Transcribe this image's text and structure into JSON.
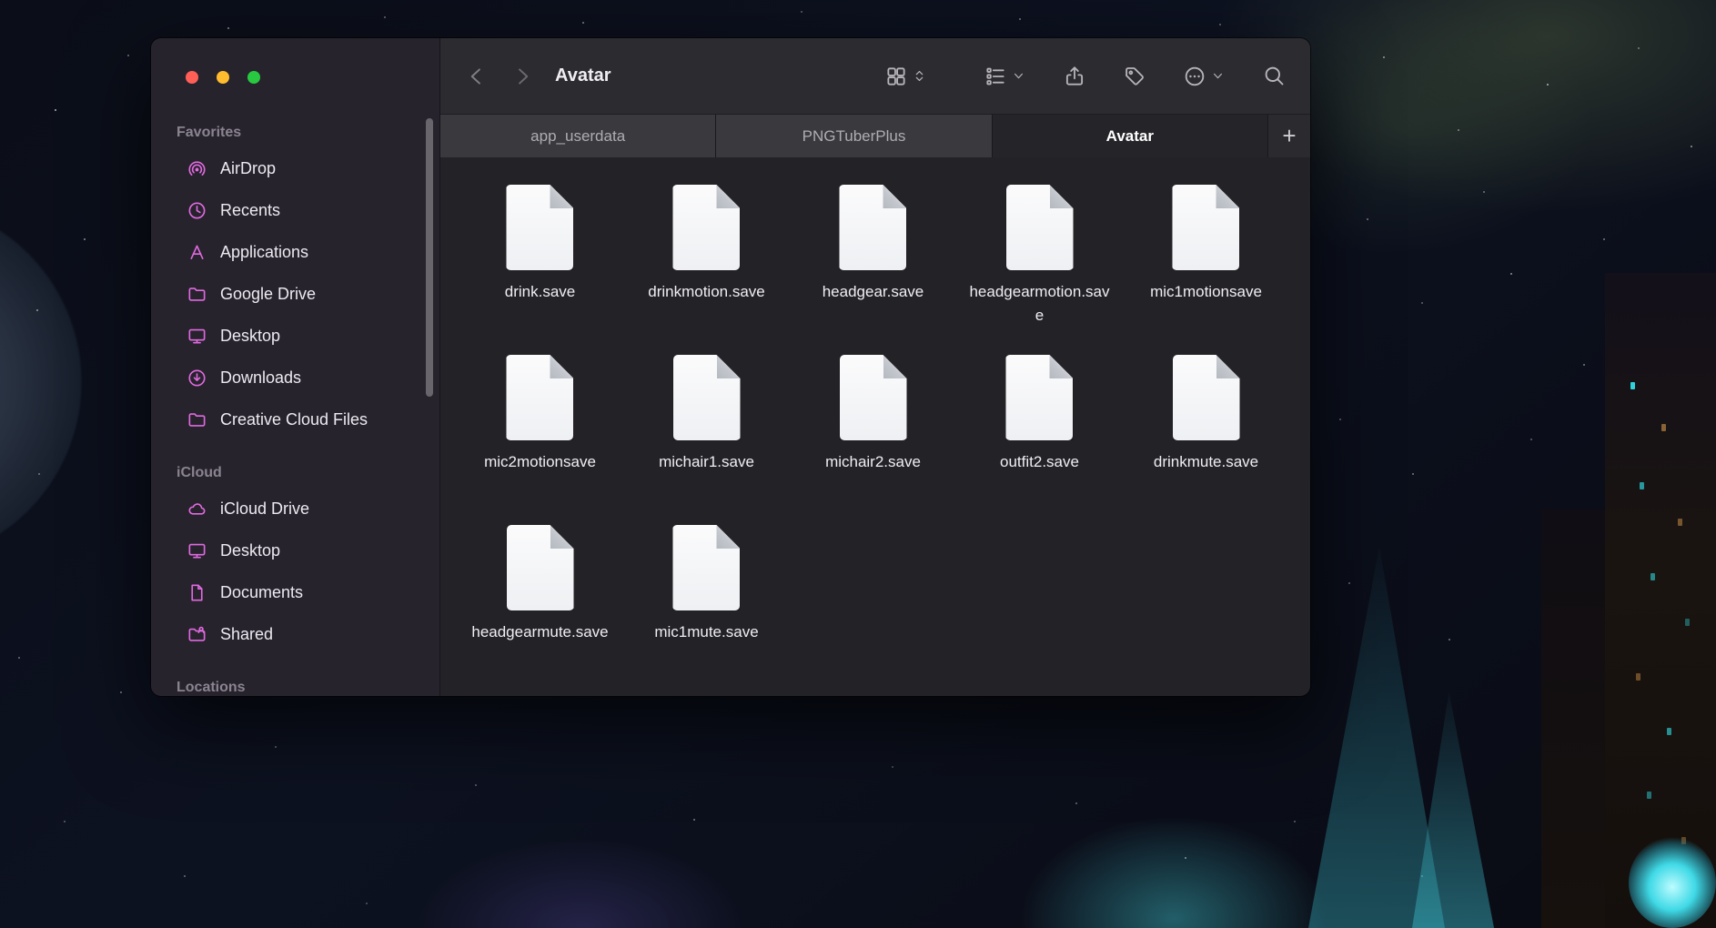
{
  "window": {
    "toolbar": {
      "title": "Avatar",
      "controls": [
        "back-icon",
        "forward-icon",
        "grid-view-icon",
        "view-stepper-icon",
        "group-view-icon",
        "chevron-down-icon",
        "share-icon",
        "tag-icon",
        "more-options-icon",
        "search-icon"
      ]
    },
    "tabs": [
      {
        "label": "app_userdata",
        "active": false
      },
      {
        "label": "PNGTuberPlus",
        "active": false
      },
      {
        "label": "Avatar",
        "active": true
      }
    ],
    "tab_add_label": "+",
    "sidebar": {
      "sections": [
        {
          "title": "Favorites",
          "items": [
            {
              "label": "AirDrop",
              "icon": "airdrop"
            },
            {
              "label": "Recents",
              "icon": "recents"
            },
            {
              "label": "Applications",
              "icon": "applications"
            },
            {
              "label": "Google Drive",
              "icon": "folder"
            },
            {
              "label": "Desktop",
              "icon": "desktop"
            },
            {
              "label": "Downloads",
              "icon": "downloads"
            },
            {
              "label": "Creative Cloud Files",
              "icon": "folder"
            }
          ]
        },
        {
          "title": "iCloud",
          "items": [
            {
              "label": "iCloud Drive",
              "icon": "icloud"
            },
            {
              "label": "Desktop",
              "icon": "desktop"
            },
            {
              "label": "Documents",
              "icon": "document"
            },
            {
              "label": "Shared",
              "icon": "shared-folder"
            }
          ]
        },
        {
          "title": "Locations",
          "items": []
        }
      ]
    },
    "files": [
      {
        "name": "drink.save"
      },
      {
        "name": "drinkmotion.save"
      },
      {
        "name": "headgear.save"
      },
      {
        "name": "headgearmotion.save"
      },
      {
        "name": "mic1motionsave"
      },
      {
        "name": "mic2motionsave"
      },
      {
        "name": "michair1.save"
      },
      {
        "name": "michair2.save"
      },
      {
        "name": "outfit2.save"
      },
      {
        "name": "drinkmute.save"
      },
      {
        "name": "headgearmute.save"
      },
      {
        "name": "mic1mute.save"
      }
    ],
    "colors": {
      "accent_pink": "#e06ae0",
      "traffic_red": "#ff5f57",
      "traffic_yellow": "#febc2e",
      "traffic_green": "#28c840"
    }
  }
}
